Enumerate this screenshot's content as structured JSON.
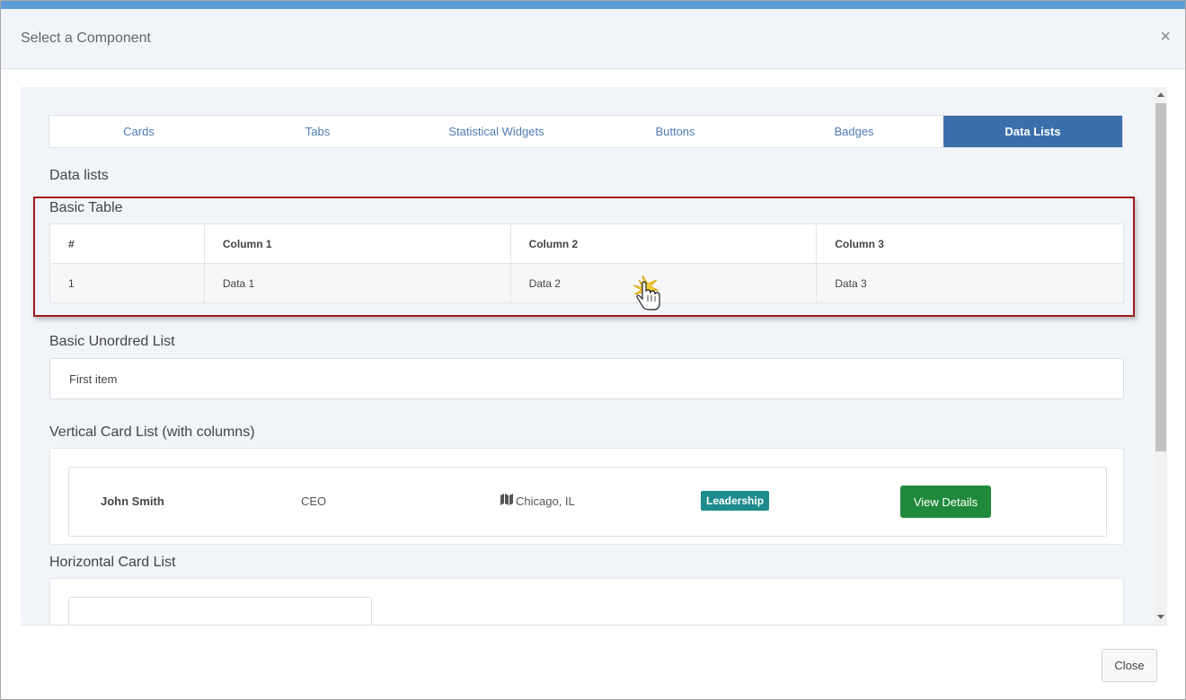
{
  "modal": {
    "title": "Select a Component",
    "close_glyph": "×",
    "close_button_label": "Close"
  },
  "tabs": [
    {
      "label": "Cards",
      "active": false
    },
    {
      "label": "Tabs",
      "active": false
    },
    {
      "label": "Statistical Widgets",
      "active": false
    },
    {
      "label": "Buttons",
      "active": false
    },
    {
      "label": "Badges",
      "active": false
    },
    {
      "label": "Data Lists",
      "active": true
    }
  ],
  "content": {
    "heading": "Data lists",
    "basic_table": {
      "title": "Basic Table",
      "headers": [
        "#",
        "Column 1",
        "Column 2",
        "Column 3"
      ],
      "rows": [
        [
          "1",
          "Data 1",
          "Data 2",
          "Data 3"
        ]
      ]
    },
    "unordered_list": {
      "title": "Basic Unordred List",
      "items": [
        "First item"
      ]
    },
    "vertical_card_list": {
      "title": "Vertical Card List (with columns)",
      "name": "John Smith",
      "role": "CEO",
      "location_icon": "map-icon",
      "location": "Chicago, IL",
      "badge": "Leadership",
      "button": "View Details"
    },
    "horizontal_card_list": {
      "title": "Horizontal Card List"
    }
  },
  "colors": {
    "accent_top_bar": "#5b9bd5",
    "active_tab": "#3b6fab",
    "tab_text": "#4f7bb5",
    "highlight_border": "#a51c1c",
    "badge": "#1e8b8e",
    "view_details_button": "#208a3c"
  }
}
